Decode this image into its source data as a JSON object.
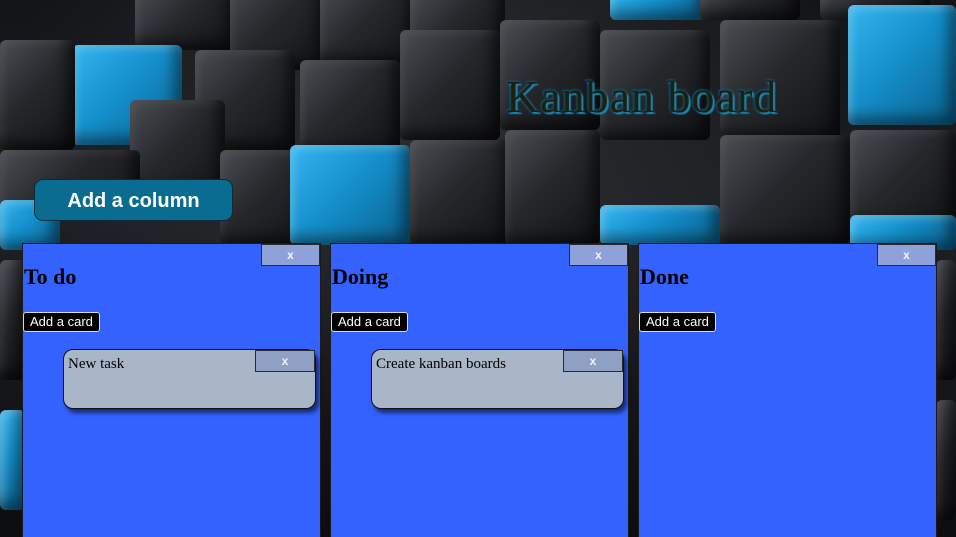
{
  "app": {
    "title": "Kanban board",
    "add_column_label": "Add a column"
  },
  "columns": [
    {
      "title": "To do",
      "close_label": "x",
      "add_card_label": "Add a card",
      "cards": [
        {
          "text": "New task",
          "close_label": "x"
        }
      ]
    },
    {
      "title": "Doing",
      "close_label": "x",
      "add_card_label": "Add a card",
      "cards": [
        {
          "text": "Create kanban boards",
          "close_label": "x"
        }
      ]
    },
    {
      "title": "Done",
      "close_label": "x",
      "add_card_label": "Add a card",
      "cards": []
    }
  ],
  "colors": {
    "column_bg": "#3362ff",
    "card_bg": "#a8b6c8",
    "add_column_bg": "#0b6c91",
    "close_bg": "#8ea1d8",
    "cube_accent": "#1590cc"
  }
}
